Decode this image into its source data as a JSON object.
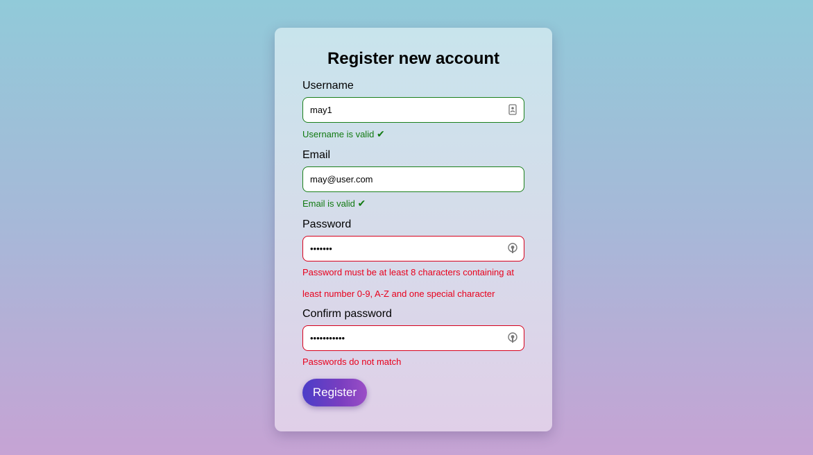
{
  "form": {
    "title": "Register new account",
    "username": {
      "label": "Username",
      "value": "may1",
      "message": "Username is valid",
      "check_mark": "✔",
      "status": "valid",
      "icon": "contact-card-icon"
    },
    "email": {
      "label": "Email",
      "value": "may@user.com",
      "message": "Email is valid",
      "check_mark": "✔",
      "status": "valid"
    },
    "password": {
      "label": "Password",
      "value": "1234567",
      "message": "Password must be at least 8 characters containing at least number 0-9, A-Z and one special character",
      "status": "invalid",
      "icon": "password-key-icon"
    },
    "confirm_password": {
      "label": "Confirm password",
      "value": "12345678901",
      "message": "Passwords do not match",
      "status": "invalid",
      "icon": "password-key-icon"
    },
    "submit_label": "Register"
  },
  "colors": {
    "valid": "#117a11",
    "invalid": "#e8001c",
    "button_start": "#4b3ec8",
    "button_end": "#9b4fc6"
  }
}
